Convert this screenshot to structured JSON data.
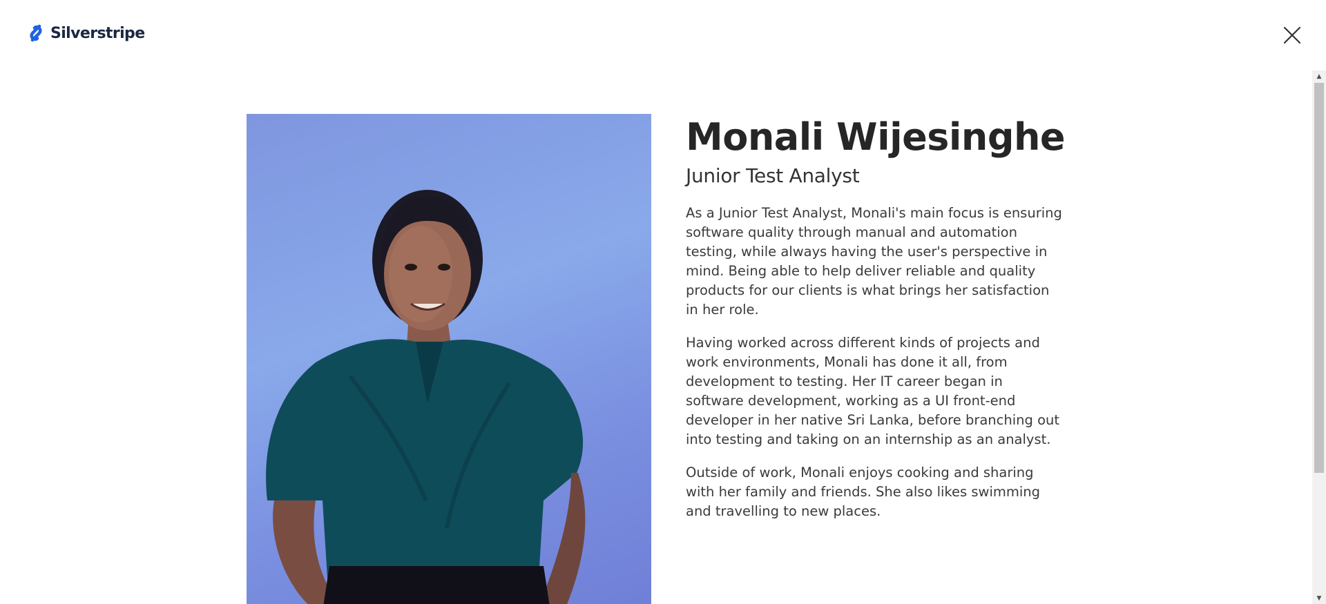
{
  "header": {
    "logo_text": "Silverstripe",
    "logo_icon": "silverstripe-s-icon",
    "close_icon": "close-icon"
  },
  "profile": {
    "photo_alt": "Monali Wijesinghe",
    "name": "Monali Wijesinghe",
    "role": "Junior Test Analyst",
    "paragraphs": [
      "As a Junior Test Analyst, Monali's main focus is ensuring software quality through manual and automation testing, while always having the user's perspective in mind. Being able to help deliver reliable and quality products for our clients is what brings her satisfaction in her role.",
      "Having worked across different kinds of projects and work environments, Monali has done it all, from development to testing. Her IT career began in software development, working as a UI front-end developer in her native Sri Lanka, before branching out into testing and taking on an internship as an analyst.",
      "Outside of work, Monali enjoys cooking and sharing with her family and friends. She also likes swimming and travelling to new places."
    ]
  },
  "colors": {
    "brand_blue": "#1f63e0",
    "text_dark": "#262626",
    "photo_background": "#7f9ae3"
  },
  "scrollbar": {
    "up_icon": "scroll-up-arrow-icon",
    "down_icon": "scroll-down-arrow-icon"
  }
}
